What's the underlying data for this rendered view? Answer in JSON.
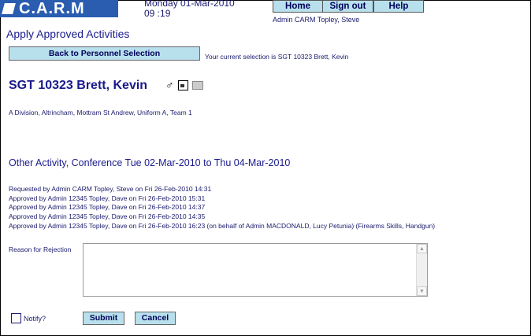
{
  "app": {
    "logo_text": "C.A.R.M"
  },
  "header": {
    "date": "Monday 01-Mar-2010",
    "time": "09 :19",
    "user": "Admin CARM Topley, Steve",
    "nav": [
      "Home",
      "Sign out",
      "Help"
    ]
  },
  "page": {
    "title": "Apply Approved Activities",
    "back_label": "Back to Personnel Selection",
    "selection_text": "Your current selection is SGT 10323 Brett, Kevin"
  },
  "person": {
    "name": "SGT 10323 Brett, Kevin",
    "unit": "A Division, Altrincham, Mottram St Andrew, Uniform A, Team 1"
  },
  "activity": {
    "title": "Other Activity,  Conference  Tue 02-Mar-2010 to Thu 04-Mar-2010"
  },
  "history": [
    "Requested by Admin CARM Topley, Steve on Fri 26-Feb-2010 14:31",
    "Approved by Admin 12345 Topley, Dave on Fri 26-Feb-2010 15:31",
    "Approved by Admin 12345 Topley, Dave on Fri 26-Feb-2010 14:37",
    "Approved by Admin 12345 Topley, Dave on Fri 26-Feb-2010 14:35",
    "Approved by Admin 12345 Topley, Dave on Fri 26-Feb-2010 16:23 (on behalf of Admin MACDONALD, Lucy Petunia) (Firearms Skills, Handgun)"
  ],
  "form": {
    "reason_label": "Reason for Rejection",
    "reason_value": "",
    "notify_label": "Notify?",
    "submit_label": "Submit",
    "cancel_label": "Cancel"
  },
  "icons": [
    "male-icon",
    "document-icon",
    "id-card-icon"
  ],
  "colors": {
    "brand": "#2a5db0",
    "button": "#b8e0ec",
    "text": "#1a1a8e"
  }
}
